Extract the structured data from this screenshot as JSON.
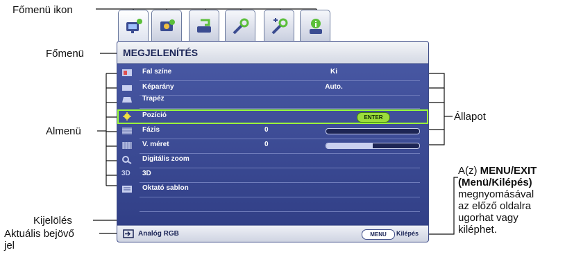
{
  "annotations": {
    "fomenu_ikon": "Főmenü ikon",
    "fomenu": "Főmenü",
    "almenu": "Almenü",
    "allapot": "Állapot",
    "kijeloles": "Kijelölés",
    "aktualis_line1": "Aktuális bejövő",
    "aktualis_line2": "jel",
    "menu_exit_prefix": "A(z) ",
    "menu_exit_bold1": "MENU/EXIT",
    "menu_exit_bold2": "(Menü/Kilépés)",
    "menu_exit_line3": "megnyomásával",
    "menu_exit_line4": "az előző oldalra",
    "menu_exit_line5": "ugorhat vagy",
    "menu_exit_line6": "kiléphet."
  },
  "tabs": [
    {
      "icon": "display-icon",
      "active": true
    },
    {
      "icon": "picture-icon",
      "active": false
    },
    {
      "icon": "source-icon",
      "active": false
    },
    {
      "icon": "setup-basic-icon",
      "active": false
    },
    {
      "icon": "setup-advanced-icon",
      "active": false
    },
    {
      "icon": "information-icon",
      "active": false
    }
  ],
  "menu": {
    "title": "MEGJELENÍTÉS",
    "rows": [
      {
        "label": "Fal színe",
        "value": "Ki",
        "icon": "wall-color-icon"
      },
      {
        "label": "Képarány",
        "value": "Auto.",
        "icon": "aspect-ratio-icon"
      },
      {
        "label": "Trapéz",
        "value": "",
        "icon": "keystone-icon"
      },
      {
        "label": "Pozíció",
        "value": "",
        "enter": "ENTER",
        "icon": "position-icon",
        "selected": true
      },
      {
        "label": "Fázis",
        "value": "0",
        "slider": 0.0,
        "icon": "phase-icon"
      },
      {
        "label": "V. méret",
        "value": "0",
        "slider": 0.5,
        "icon": "h-size-icon"
      },
      {
        "label": "Digitális zoom",
        "value": "",
        "icon": "digital-zoom-icon"
      },
      {
        "label": "3D",
        "value": "",
        "icon": "3d-icon"
      },
      {
        "label": "Oktató sablon",
        "value": "",
        "icon": "teaching-template-icon"
      },
      {
        "label": "",
        "value": "",
        "icon": ""
      },
      {
        "label": "",
        "value": "",
        "icon": ""
      }
    ],
    "source": "Analóg RGB",
    "menu_button": "MENU",
    "exit_label": "Kilépés"
  },
  "colors": {
    "menu_background": "#3a4994",
    "highlight": "#9bff3a",
    "title_text": "#1b2557"
  }
}
